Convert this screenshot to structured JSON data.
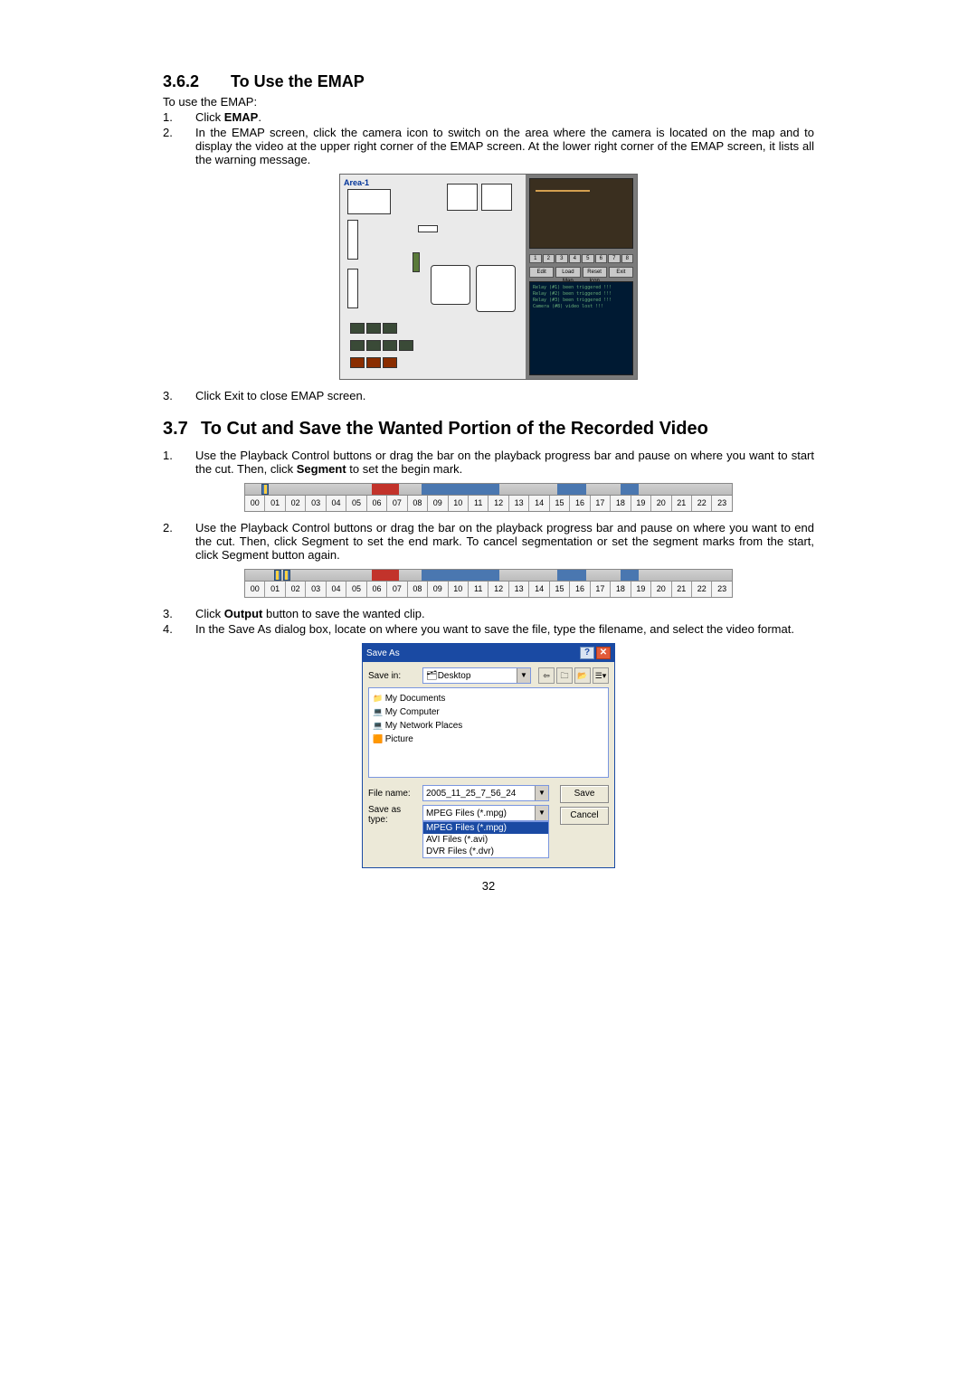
{
  "section362": {
    "number": "3.6.2",
    "title": "To Use the EMAP",
    "intro": "To use the EMAP:",
    "steps": [
      {
        "n": "1.",
        "t_pre": "Click ",
        "bold": "EMAP",
        "t_post": "."
      },
      {
        "n": "2.",
        "t": "In the EMAP screen, click the camera icon to switch on the area where the camera is located on the map and to display the video at the upper right corner of the EMAP screen. At the lower right corner of the EMAP screen, it lists all the warning message."
      }
    ],
    "step3": {
      "n": "3.",
      "t": "Click Exit to close EMAP screen."
    }
  },
  "emap": {
    "area_label": "Area-1",
    "numbtns": [
      "1",
      "2",
      "3",
      "4",
      "5",
      "6",
      "7",
      "8"
    ],
    "ctrls": [
      "Edit",
      "Load Map",
      "Reset Icon",
      "Exit"
    ],
    "log": "Relay (#1) been triggered !!!\nRelay (#2) been triggered !!!\nRelay (#3) been triggered !!!\nCamera (#8) video lost !!!"
  },
  "section37": {
    "number": "3.7",
    "title": "To Cut and Save the Wanted Portion of the Recorded Video",
    "steps1": [
      {
        "n": "1.",
        "t_pre": "Use the Playback Control buttons or drag the bar on the playback progress bar and pause on where you want to start the cut. Then, click ",
        "bold": "Segment",
        "t_post": " to set the begin mark."
      }
    ],
    "steps2": [
      {
        "n": "2.",
        "t": "Use the Playback Control buttons or drag the bar on the playback progress bar and pause on where you want to end the cut. Then, click Segment to set the end mark. To cancel segmentation or set the segment marks from the start, click Segment button again."
      }
    ],
    "steps3": [
      {
        "n": "3.",
        "t_pre": "Click ",
        "bold": "Output",
        "t_post": " button to save the wanted clip."
      },
      {
        "n": "4.",
        "t": "In the Save As dialog box, locate on where you want to save the file, type the filename, and select the video format."
      }
    ]
  },
  "timeline": {
    "hours": [
      "00",
      "01",
      "02",
      "03",
      "04",
      "05",
      "06",
      "07",
      "08",
      "09",
      "10",
      "11",
      "12",
      "13",
      "14",
      "15",
      "16",
      "17",
      "18",
      "19",
      "20",
      "21",
      "22",
      "23"
    ]
  },
  "saveas": {
    "title": "Save As",
    "savein_label": "Save in:",
    "savein_value": "Desktop",
    "list": [
      {
        "cls": "item",
        "label": "My Documents"
      },
      {
        "cls": "item net",
        "label": "My Computer"
      },
      {
        "cls": "item net",
        "label": "My Network Places"
      },
      {
        "cls": "item pic",
        "label": "Picture"
      }
    ],
    "filename_label": "File name:",
    "filename_value": "2005_11_25_7_56_24",
    "type_label": "Save as type:",
    "type_value": "MPEG Files (*.mpg)",
    "type_options": [
      "MPEG Files (*.mpg)",
      "AVI Files (*.avi)",
      "DVR Files (*.dvr)"
    ],
    "save_btn": "Save",
    "cancel_btn": "Cancel"
  },
  "page_number": "32"
}
